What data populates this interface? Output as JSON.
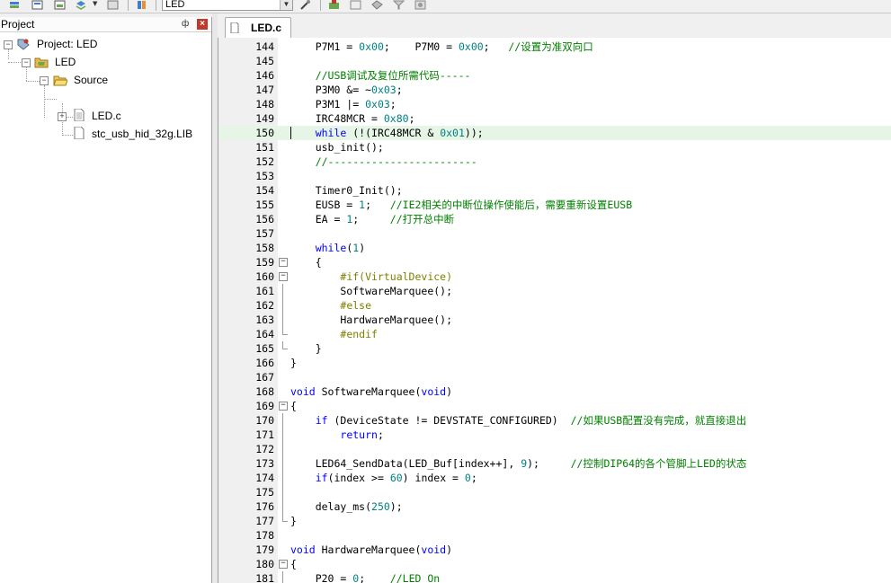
{
  "toolbar": {
    "target": "LED",
    "icons": [
      "build-stack-icon",
      "batch-build-icon",
      "translate-icon",
      "options-dropdown-icon",
      "manage-icon",
      "download-icon",
      "debug-icon",
      "insert-icon",
      "window-icon",
      "configure-icon",
      "filter-icon",
      "books-icon"
    ]
  },
  "project_panel": {
    "title": "Project",
    "pin": "ф",
    "close": "×",
    "tree": {
      "project": "Project: LED",
      "target": "LED",
      "group": "Source",
      "files": [
        "LED.c",
        "stc_usb_hid_32g.LIB"
      ]
    }
  },
  "editor": {
    "tab": "LED.c",
    "current_line": 150,
    "lines": [
      {
        "n": "144",
        "t": [
          [
            "",
            "    P7M1 = "
          ],
          [
            "num",
            "0x00"
          ],
          [
            "",
            ";    P7M0 = "
          ],
          [
            "num",
            "0x00"
          ],
          [
            "",
            ";   "
          ],
          [
            "cm",
            "//设置为准双向口"
          ]
        ]
      },
      {
        "n": "145",
        "t": []
      },
      {
        "n": "146",
        "t": [
          [
            "",
            "    "
          ],
          [
            "cm",
            "//USB调试及复位所需代码-----"
          ]
        ]
      },
      {
        "n": "147",
        "t": [
          [
            "",
            "    P3M0 &= ~"
          ],
          [
            "num",
            "0x03"
          ],
          [
            "",
            ";"
          ]
        ]
      },
      {
        "n": "148",
        "t": [
          [
            "",
            "    P3M1 |= "
          ],
          [
            "num",
            "0x03"
          ],
          [
            "",
            ";"
          ]
        ]
      },
      {
        "n": "149",
        "t": [
          [
            "",
            "    IRC48MCR = "
          ],
          [
            "num",
            "0x80"
          ],
          [
            "",
            ";"
          ]
        ]
      },
      {
        "n": "150",
        "t": [
          [
            "",
            "    "
          ],
          [
            "kw",
            "while"
          ],
          [
            "",
            " (!(IRC48MCR & "
          ],
          [
            "num",
            "0x01"
          ],
          [
            "",
            "));"
          ]
        ]
      },
      {
        "n": "151",
        "t": [
          [
            "",
            "    usb_init();"
          ]
        ]
      },
      {
        "n": "152",
        "t": [
          [
            "",
            "    "
          ],
          [
            "cm",
            "//------------------------"
          ]
        ]
      },
      {
        "n": "153",
        "t": []
      },
      {
        "n": "154",
        "t": [
          [
            "",
            "    Timer0_Init();"
          ]
        ]
      },
      {
        "n": "155",
        "t": [
          [
            "",
            "    EUSB = "
          ],
          [
            "num",
            "1"
          ],
          [
            "",
            ";   "
          ],
          [
            "cm",
            "//IE2相关的中断位操作使能后，需要重新设置EUSB"
          ]
        ]
      },
      {
        "n": "156",
        "t": [
          [
            "",
            "    EA = "
          ],
          [
            "num",
            "1"
          ],
          [
            "",
            ";     "
          ],
          [
            "cm",
            "//打开总中断"
          ]
        ]
      },
      {
        "n": "157",
        "t": []
      },
      {
        "n": "158",
        "t": [
          [
            "",
            "    "
          ],
          [
            "kw",
            "while"
          ],
          [
            "",
            "("
          ],
          [
            "num",
            "1"
          ],
          [
            "",
            ")"
          ]
        ]
      },
      {
        "n": "159",
        "t": [
          [
            "",
            "    {"
          ]
        ]
      },
      {
        "n": "160",
        "t": [
          [
            "",
            "        "
          ],
          [
            "pp",
            "#if(VirtualDevice)"
          ]
        ]
      },
      {
        "n": "161",
        "t": [
          [
            "",
            "        SoftwareMarquee();"
          ]
        ]
      },
      {
        "n": "162",
        "t": [
          [
            "",
            "        "
          ],
          [
            "pp",
            "#else"
          ]
        ]
      },
      {
        "n": "163",
        "t": [
          [
            "",
            "        HardwareMarquee();"
          ]
        ]
      },
      {
        "n": "164",
        "t": [
          [
            "",
            "        "
          ],
          [
            "pp",
            "#endif"
          ]
        ]
      },
      {
        "n": "165",
        "t": [
          [
            "",
            "    }"
          ]
        ]
      },
      {
        "n": "166",
        "t": [
          [
            "",
            "}"
          ]
        ]
      },
      {
        "n": "167",
        "t": []
      },
      {
        "n": "168",
        "t": [
          [
            "kw",
            "void"
          ],
          [
            "",
            " SoftwareMarquee("
          ],
          [
            "kw",
            "void"
          ],
          [
            "",
            ")"
          ]
        ]
      },
      {
        "n": "169",
        "t": [
          [
            "",
            "{"
          ]
        ]
      },
      {
        "n": "170",
        "t": [
          [
            "",
            "    "
          ],
          [
            "kw",
            "if"
          ],
          [
            "",
            " (DeviceState != DEVSTATE_CONFIGURED)  "
          ],
          [
            "cm",
            "//如果USB配置没有完成，就直接退出"
          ]
        ]
      },
      {
        "n": "171",
        "t": [
          [
            "",
            "        "
          ],
          [
            "kw",
            "return"
          ],
          [
            "",
            ";"
          ]
        ]
      },
      {
        "n": "172",
        "t": []
      },
      {
        "n": "173",
        "t": [
          [
            "",
            "    LED64_SendData(LED_Buf[index++], "
          ],
          [
            "num",
            "9"
          ],
          [
            "",
            ");     "
          ],
          [
            "cm",
            "//控制DIP64的各个管脚上LED的状态"
          ]
        ]
      },
      {
        "n": "174",
        "t": [
          [
            "",
            "    "
          ],
          [
            "kw",
            "if"
          ],
          [
            "",
            "(index >= "
          ],
          [
            "num",
            "60"
          ],
          [
            "",
            ") index = "
          ],
          [
            "num",
            "0"
          ],
          [
            "",
            ";"
          ]
        ]
      },
      {
        "n": "175",
        "t": []
      },
      {
        "n": "176",
        "t": [
          [
            "",
            "    delay_ms("
          ],
          [
            "num",
            "250"
          ],
          [
            "",
            ");"
          ]
        ]
      },
      {
        "n": "177",
        "t": [
          [
            "",
            "}"
          ]
        ]
      },
      {
        "n": "178",
        "t": []
      },
      {
        "n": "179",
        "t": [
          [
            "kw",
            "void"
          ],
          [
            "",
            " HardwareMarquee("
          ],
          [
            "kw",
            "void"
          ],
          [
            "",
            ")"
          ]
        ]
      },
      {
        "n": "180",
        "t": [
          [
            "",
            "{"
          ]
        ]
      },
      {
        "n": "181",
        "t": [
          [
            "",
            "    P20 = "
          ],
          [
            "num",
            "0"
          ],
          [
            "",
            ";    "
          ],
          [
            "cm",
            "//LED On"
          ]
        ]
      }
    ]
  }
}
